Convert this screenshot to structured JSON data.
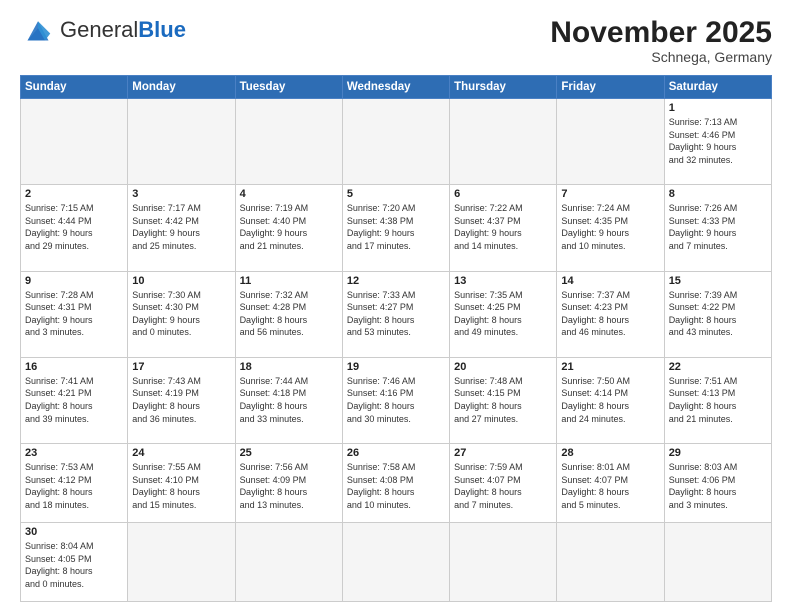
{
  "header": {
    "logo_general": "General",
    "logo_blue": "Blue",
    "month_title": "November 2025",
    "subtitle": "Schnega, Germany"
  },
  "weekdays": [
    "Sunday",
    "Monday",
    "Tuesday",
    "Wednesday",
    "Thursday",
    "Friday",
    "Saturday"
  ],
  "days": [
    {
      "num": "",
      "info": "",
      "empty": true
    },
    {
      "num": "",
      "info": "",
      "empty": true
    },
    {
      "num": "",
      "info": "",
      "empty": true
    },
    {
      "num": "",
      "info": "",
      "empty": true
    },
    {
      "num": "",
      "info": "",
      "empty": true
    },
    {
      "num": "",
      "info": "",
      "empty": true
    },
    {
      "num": "1",
      "info": "Sunrise: 7:13 AM\nSunset: 4:46 PM\nDaylight: 9 hours\nand 32 minutes.",
      "empty": false
    },
    {
      "num": "2",
      "info": "Sunrise: 7:15 AM\nSunset: 4:44 PM\nDaylight: 9 hours\nand 29 minutes.",
      "empty": false
    },
    {
      "num": "3",
      "info": "Sunrise: 7:17 AM\nSunset: 4:42 PM\nDaylight: 9 hours\nand 25 minutes.",
      "empty": false
    },
    {
      "num": "4",
      "info": "Sunrise: 7:19 AM\nSunset: 4:40 PM\nDaylight: 9 hours\nand 21 minutes.",
      "empty": false
    },
    {
      "num": "5",
      "info": "Sunrise: 7:20 AM\nSunset: 4:38 PM\nDaylight: 9 hours\nand 17 minutes.",
      "empty": false
    },
    {
      "num": "6",
      "info": "Sunrise: 7:22 AM\nSunset: 4:37 PM\nDaylight: 9 hours\nand 14 minutes.",
      "empty": false
    },
    {
      "num": "7",
      "info": "Sunrise: 7:24 AM\nSunset: 4:35 PM\nDaylight: 9 hours\nand 10 minutes.",
      "empty": false
    },
    {
      "num": "8",
      "info": "Sunrise: 7:26 AM\nSunset: 4:33 PM\nDaylight: 9 hours\nand 7 minutes.",
      "empty": false
    },
    {
      "num": "9",
      "info": "Sunrise: 7:28 AM\nSunset: 4:31 PM\nDaylight: 9 hours\nand 3 minutes.",
      "empty": false
    },
    {
      "num": "10",
      "info": "Sunrise: 7:30 AM\nSunset: 4:30 PM\nDaylight: 9 hours\nand 0 minutes.",
      "empty": false
    },
    {
      "num": "11",
      "info": "Sunrise: 7:32 AM\nSunset: 4:28 PM\nDaylight: 8 hours\nand 56 minutes.",
      "empty": false
    },
    {
      "num": "12",
      "info": "Sunrise: 7:33 AM\nSunset: 4:27 PM\nDaylight: 8 hours\nand 53 minutes.",
      "empty": false
    },
    {
      "num": "13",
      "info": "Sunrise: 7:35 AM\nSunset: 4:25 PM\nDaylight: 8 hours\nand 49 minutes.",
      "empty": false
    },
    {
      "num": "14",
      "info": "Sunrise: 7:37 AM\nSunset: 4:23 PM\nDaylight: 8 hours\nand 46 minutes.",
      "empty": false
    },
    {
      "num": "15",
      "info": "Sunrise: 7:39 AM\nSunset: 4:22 PM\nDaylight: 8 hours\nand 43 minutes.",
      "empty": false
    },
    {
      "num": "16",
      "info": "Sunrise: 7:41 AM\nSunset: 4:21 PM\nDaylight: 8 hours\nand 39 minutes.",
      "empty": false
    },
    {
      "num": "17",
      "info": "Sunrise: 7:43 AM\nSunset: 4:19 PM\nDaylight: 8 hours\nand 36 minutes.",
      "empty": false
    },
    {
      "num": "18",
      "info": "Sunrise: 7:44 AM\nSunset: 4:18 PM\nDaylight: 8 hours\nand 33 minutes.",
      "empty": false
    },
    {
      "num": "19",
      "info": "Sunrise: 7:46 AM\nSunset: 4:16 PM\nDaylight: 8 hours\nand 30 minutes.",
      "empty": false
    },
    {
      "num": "20",
      "info": "Sunrise: 7:48 AM\nSunset: 4:15 PM\nDaylight: 8 hours\nand 27 minutes.",
      "empty": false
    },
    {
      "num": "21",
      "info": "Sunrise: 7:50 AM\nSunset: 4:14 PM\nDaylight: 8 hours\nand 24 minutes.",
      "empty": false
    },
    {
      "num": "22",
      "info": "Sunrise: 7:51 AM\nSunset: 4:13 PM\nDaylight: 8 hours\nand 21 minutes.",
      "empty": false
    },
    {
      "num": "23",
      "info": "Sunrise: 7:53 AM\nSunset: 4:12 PM\nDaylight: 8 hours\nand 18 minutes.",
      "empty": false
    },
    {
      "num": "24",
      "info": "Sunrise: 7:55 AM\nSunset: 4:10 PM\nDaylight: 8 hours\nand 15 minutes.",
      "empty": false
    },
    {
      "num": "25",
      "info": "Sunrise: 7:56 AM\nSunset: 4:09 PM\nDaylight: 8 hours\nand 13 minutes.",
      "empty": false
    },
    {
      "num": "26",
      "info": "Sunrise: 7:58 AM\nSunset: 4:08 PM\nDaylight: 8 hours\nand 10 minutes.",
      "empty": false
    },
    {
      "num": "27",
      "info": "Sunrise: 7:59 AM\nSunset: 4:07 PM\nDaylight: 8 hours\nand 7 minutes.",
      "empty": false
    },
    {
      "num": "28",
      "info": "Sunrise: 8:01 AM\nSunset: 4:07 PM\nDaylight: 8 hours\nand 5 minutes.",
      "empty": false
    },
    {
      "num": "29",
      "info": "Sunrise: 8:03 AM\nSunset: 4:06 PM\nDaylight: 8 hours\nand 3 minutes.",
      "empty": false
    },
    {
      "num": "30",
      "info": "Sunrise: 8:04 AM\nSunset: 4:05 PM\nDaylight: 8 hours\nand 0 minutes.",
      "empty": false
    },
    {
      "num": "",
      "info": "",
      "empty": true
    },
    {
      "num": "",
      "info": "",
      "empty": true
    },
    {
      "num": "",
      "info": "",
      "empty": true
    },
    {
      "num": "",
      "info": "",
      "empty": true
    },
    {
      "num": "",
      "info": "",
      "empty": true
    },
    {
      "num": "",
      "info": "",
      "empty": true
    }
  ]
}
